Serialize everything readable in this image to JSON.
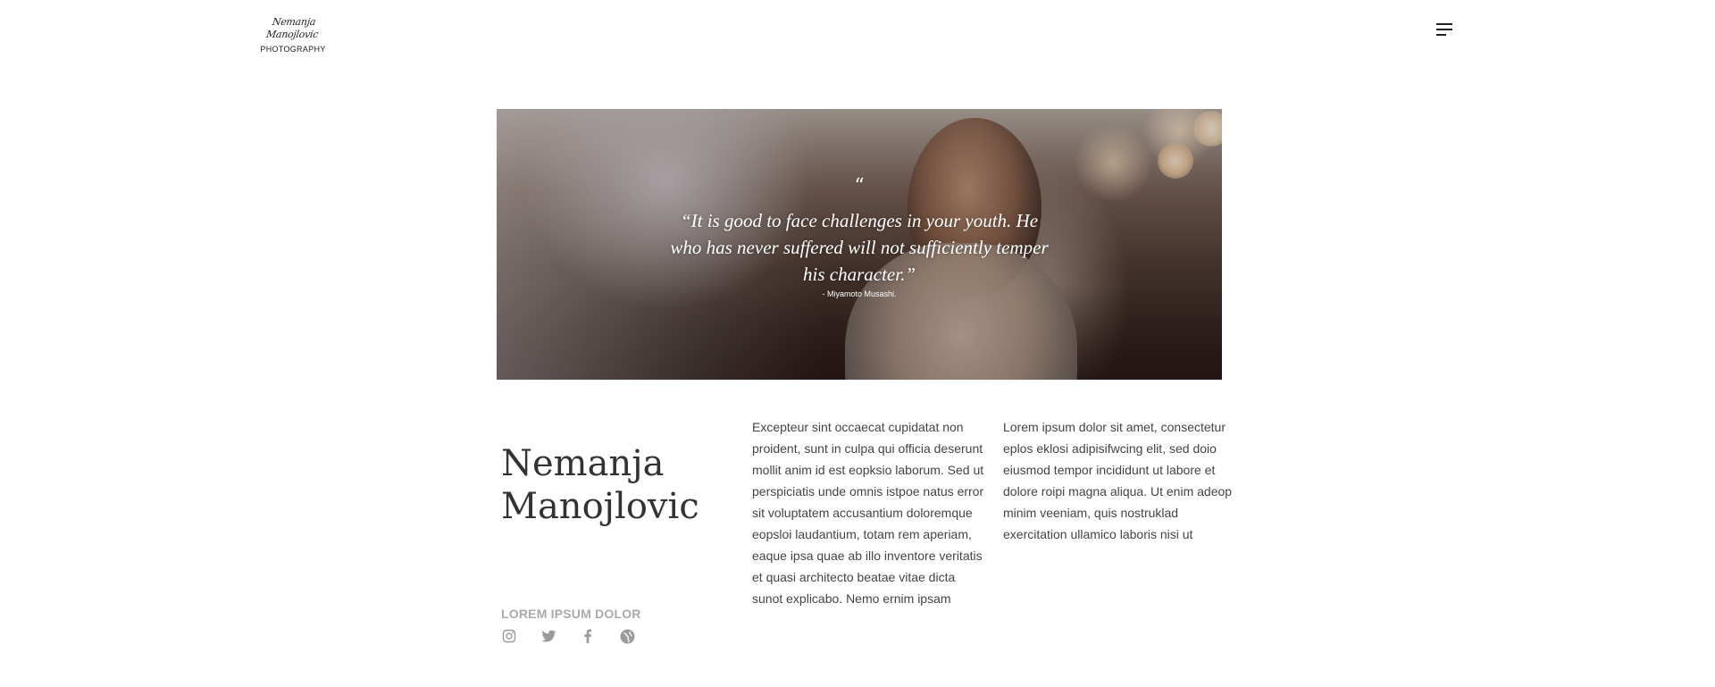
{
  "header": {
    "logo_script": "Nemanja Manojlovic",
    "logo_sub": "PHOTOGRAPHY"
  },
  "hero": {
    "quote_mark": "“",
    "quote": "“It is good to face challenges in your youth. He who has never suffered will not sufficiently temper his character.”",
    "author": "- Miyamoto Musashi."
  },
  "profile": {
    "name": "Nemanja Manojlovic",
    "section_label": "LOREM IPSUM DOLOR",
    "socials": [
      "instagram-icon",
      "twitter-icon",
      "facebook-icon",
      "globe-icon"
    ]
  },
  "columns": {
    "col1": "Excepteur sint occaecat cupidatat non proident, sunt in culpa qui officia deserunt mollit anim id est eopksio laborum. Sed ut perspiciatis unde omnis istpoe natus error sit voluptatem accusantium doloremque eopsloi laudantium, totam rem aperiam, eaque ipsa quae ab illo inventore veritatis et quasi architecto beatae vitae dicta sunot explicabo. Nemo ernim ipsam",
    "col2": "Lorem ipsum dolor sit amet, consectetur eplos eklosi adipisifwcing elit, sed doio eiusmod tempor incididunt ut labore et dolore roipi magna aliqua. Ut enim adeop minim veeniam, quis nostruklad exercitation ullamico laboris nisi ut"
  }
}
